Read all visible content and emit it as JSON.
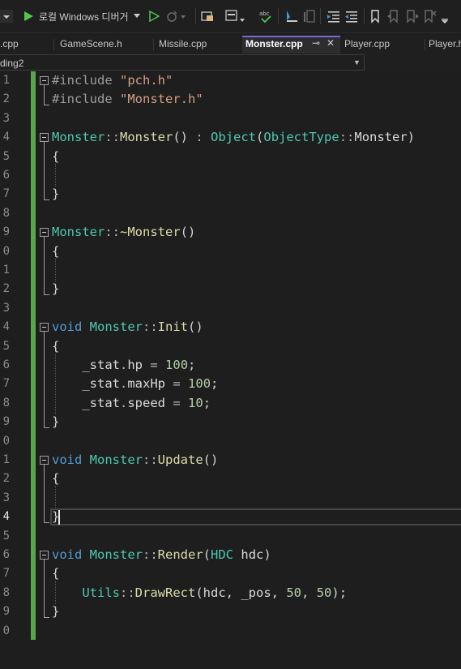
{
  "toolbar": {
    "debugger_label": "로컬 Windows 디버거",
    "icons": [
      "dropdown-icon",
      "start-debug-icon",
      "start-without-debug-icon",
      "hot-reload-icon",
      "solution-explorer-icon",
      "window-layout-icon",
      "spell-check-icon",
      "breakpoint-icon",
      "format-icon",
      "indent-icon",
      "outdent-icon",
      "bookmark-icon",
      "prev-bookmark-icon",
      "next-bookmark-icon",
      "clear-bookmarks-icon"
    ]
  },
  "tabs": [
    {
      "label": ".cpp"
    },
    {
      "label": "GameScene.h"
    },
    {
      "label": "Missile.cpp"
    },
    {
      "label": "Monster.cpp",
      "active": true
    },
    {
      "label": "Player.cpp"
    },
    {
      "label": "Player.h"
    }
  ],
  "tab_pin_icon": "⊸",
  "tab_close_icon": "✕",
  "navbar": {
    "project": "ding2"
  },
  "line_numbers": [
    "1",
    "2",
    "3",
    "4",
    "5",
    "6",
    "7",
    "8",
    "9",
    "0",
    "1",
    "2",
    "3",
    "4",
    "5",
    "6",
    "7",
    "8",
    "9",
    "0",
    "1",
    "2",
    "3",
    "4",
    "5",
    "6",
    "7",
    "8",
    "9",
    "0"
  ],
  "current_line_index": 23,
  "code": [
    [
      [
        "pp",
        "#include "
      ],
      [
        "str",
        "\"pch.h\""
      ]
    ],
    [
      [
        "pp",
        "#include "
      ],
      [
        "str",
        "\"Monster.h\""
      ]
    ],
    [],
    [
      [
        "ty",
        "Monster"
      ],
      [
        "op",
        "::"
      ],
      [
        "fn",
        "Monster"
      ],
      [
        "",
        "() "
      ],
      [
        "op",
        ":"
      ],
      [
        "",
        " "
      ],
      [
        "ty",
        "Object"
      ],
      [
        "",
        "("
      ],
      [
        "ty",
        "ObjectType"
      ],
      [
        "op",
        "::"
      ],
      [
        "mem",
        "Monster"
      ],
      [
        "",
        ")"
      ]
    ],
    [
      [
        "",
        "{"
      ]
    ],
    [],
    [
      [
        "",
        "}"
      ]
    ],
    [],
    [
      [
        "ty",
        "Monster"
      ],
      [
        "op",
        "::"
      ],
      [
        "fn",
        "~Monster"
      ],
      [
        "",
        "()"
      ]
    ],
    [
      [
        "",
        "{"
      ]
    ],
    [],
    [
      [
        "",
        "}"
      ]
    ],
    [],
    [
      [
        "kw",
        "void"
      ],
      [
        "",
        " "
      ],
      [
        "ty",
        "Monster"
      ],
      [
        "op",
        "::"
      ],
      [
        "fn",
        "Init"
      ],
      [
        "",
        "()"
      ]
    ],
    [
      [
        "",
        "{"
      ]
    ],
    [
      [
        "",
        "    "
      ],
      [
        "mem",
        "_stat"
      ],
      [
        "op",
        "."
      ],
      [
        "mem",
        "hp"
      ],
      [
        "",
        " "
      ],
      [
        "op",
        "="
      ],
      [
        "",
        " "
      ],
      [
        "num",
        "100"
      ],
      [
        "",
        ";"
      ]
    ],
    [
      [
        "",
        "    "
      ],
      [
        "mem",
        "_stat"
      ],
      [
        "op",
        "."
      ],
      [
        "mem",
        "maxHp"
      ],
      [
        "",
        " "
      ],
      [
        "op",
        "="
      ],
      [
        "",
        " "
      ],
      [
        "num",
        "100"
      ],
      [
        "",
        ";"
      ]
    ],
    [
      [
        "",
        "    "
      ],
      [
        "mem",
        "_stat"
      ],
      [
        "op",
        "."
      ],
      [
        "mem",
        "speed"
      ],
      [
        "",
        " "
      ],
      [
        "op",
        "="
      ],
      [
        "",
        " "
      ],
      [
        "num",
        "10"
      ],
      [
        "",
        ";"
      ]
    ],
    [
      [
        "",
        "}"
      ]
    ],
    [],
    [
      [
        "kw",
        "void"
      ],
      [
        "",
        " "
      ],
      [
        "ty",
        "Monster"
      ],
      [
        "op",
        "::"
      ],
      [
        "fn",
        "Update"
      ],
      [
        "",
        "()"
      ]
    ],
    [
      [
        "",
        "{"
      ]
    ],
    [],
    [
      [
        "",
        "}"
      ]
    ],
    [],
    [
      [
        "kw",
        "void"
      ],
      [
        "",
        " "
      ],
      [
        "ty",
        "Monster"
      ],
      [
        "op",
        "::"
      ],
      [
        "fn",
        "Render"
      ],
      [
        "",
        "("
      ],
      [
        "ty",
        "HDC"
      ],
      [
        "",
        " "
      ],
      [
        "mem",
        "hdc"
      ],
      [
        "",
        ")"
      ]
    ],
    [
      [
        "",
        "{"
      ]
    ],
    [
      [
        "",
        "    "
      ],
      [
        "ty",
        "Utils"
      ],
      [
        "op",
        "::"
      ],
      [
        "fn",
        "DrawRect"
      ],
      [
        "",
        "("
      ],
      [
        "mem",
        "hdc"
      ],
      [
        "",
        ", "
      ],
      [
        "mem",
        "_pos"
      ],
      [
        "",
        ", "
      ],
      [
        "num",
        "50"
      ],
      [
        "",
        ", "
      ],
      [
        "num",
        "50"
      ],
      [
        "",
        ");"
      ]
    ],
    [
      [
        "",
        "}"
      ]
    ],
    []
  ]
}
